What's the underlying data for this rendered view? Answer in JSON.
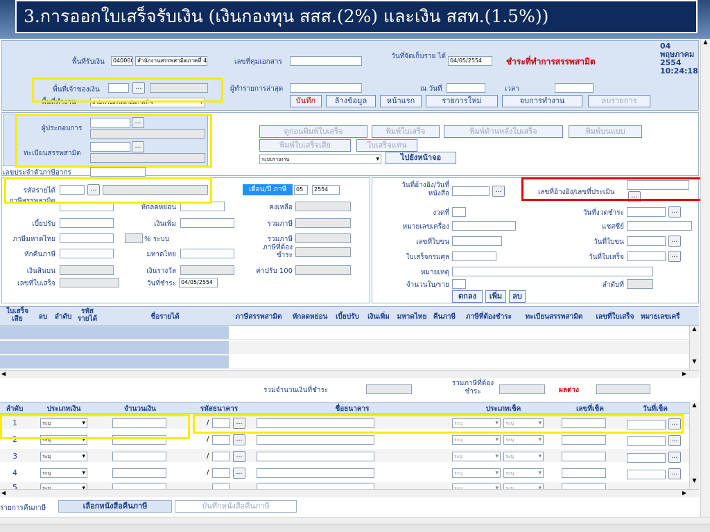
{
  "slide_title": "3.การออกใบเสร็จรับเงิน (เงินกองทุน สสส.(2%) และเงิน สสท.(1.5%))",
  "header": {
    "area_receive_label": "พื้นที่รับเงิน",
    "area_receive_code": "040000",
    "area_receive_name": "สำนักงานสรรพสามิตภาคที่ 4",
    "control_doc_label": "เลขที่คุมเอกสาร",
    "collect_date_label": "วันที่จัดเก็บราย ได้",
    "collect_date": "04/05/2554",
    "office_title": "ชำระที่ทำการสรรพสามิต",
    "clock_day": "04",
    "clock_month": "พฤษภาคม",
    "clock_year": "2554",
    "clock_time": "10:24:18",
    "owner_area_label": "พื้นที่เจ้าของเงิน",
    "work_area_label": "พื้นที่ทำงาน",
    "work_area_value": "สำนักงานสรรพสามิตภาคที่ 4",
    "last_editor_label": "ผู้ทำรายการล่าสุด",
    "at_date_label": "ณ วันที่",
    "time_label": "เวลา"
  },
  "toolbar": {
    "save": "บันทึก",
    "clear": "ล้างข้อมูล",
    "home": "หน้าแรก",
    "new_item": "รายการใหม่",
    "end_work": "จบการทำงาน",
    "delete_item": "ลบรายการ"
  },
  "operator": {
    "operator_label": "ผู้ประกอบการ",
    "excise_reg_label": "ทะเบียนสรรพสามิต",
    "tax_id_label": "เลขประจำตัวภาษีอากร"
  },
  "print_buttons": {
    "preview": "ดูก่อนพิมพ์ใบเสร็จ",
    "print_receipt": "พิมพ์ใบเสร็จ",
    "print_back": "พิมพ์ด้านหลังใบเสร็จ",
    "print_form": "พิมพ์บนแบบ",
    "print_void": "พิมพ์ใบเสร็จเสีย",
    "replace": "ใบเสร็จแทน",
    "goto_page": "ไปยังหน้าจอ",
    "select_placeholder": "ระบบรายงาน"
  },
  "revenue": {
    "code_label": "รหัสรายได้",
    "excise_label": "ภาษีสรรพสามิต",
    "surcharge_label": "เงินเพิ่ม",
    "interior_label": "ภาษีมหาดไทย",
    "refund_label": "หักคืนภาษี",
    "income_label": "เงินสินบน",
    "receipt_no_label": "เลขที่ใบเสร็จ",
    "deduct_label": "หักลดหย่อน",
    "penalty_label": "เบี้ยปรับ",
    "pct_label": "% ระบบ",
    "mahadthai_label": "มหาดไทย",
    "reward_label": "เงินรางวัล",
    "paydate_label": "วันที่ชำระ",
    "paydate_value": "04/05/2554",
    "month_year_label": "เดือน/ปี ภาษี",
    "month_value": "05",
    "year_value": "2554",
    "remain_label": "คงเหลือ",
    "total_tax_label": "รวมภาษี",
    "total_tax2_label": "รวมภาษี",
    "tax_due_label": "ภาษีที่ต้องชำระ",
    "fine100_label": "ค่าปรับ 100"
  },
  "reference": {
    "ref_date_label": "วันที่อ้างอิง/วันที่ หนังสือ",
    "ref_no_label": "เลขที่อ้างอิง/เลขที่ประเมิน",
    "period_label": "งวดที่",
    "period_date_label": "วันที่งวดชำระ",
    "machine_label": "หมายเลขเครื่อง",
    "chassis_label": "แชสซีย์",
    "license_label": "เลขที่ใบขน",
    "license_date_label": "วันที่ใบขน",
    "customs_receipt_label": "ใบเสร็จกรมศุล",
    "receipt_date_label": "วันที่ใบเสร็จ",
    "remark_label": "หมายเหตุ",
    "qty_label": "จำนวนใบ/ราย",
    "seq_label": "ลำดับที่",
    "ok": "ตกลง",
    "add": "เพิ่ม",
    "delete": "ลบ"
  },
  "grid": {
    "headers": [
      "ใบเสร็จ เสีย",
      "ลบ",
      "ลำดับ",
      "รหัส รายได้",
      "ชื่อรายได้",
      "ภาษีสรรพสามิต",
      "หักลดหย่อน",
      "เบี้ยปรับ",
      "เงินเพิ่ม",
      "มหาดไทย",
      "คืนภาษี",
      "ภาษีที่ต้องชำระ",
      "ทะเบียนสรรพสามิต",
      "เลขที่ใบเสร็จ",
      "หมายเลขเครื่"
    ]
  },
  "totals": {
    "total_pay_label": "รวมจำนวนเงินที่ชำระ",
    "total_tax_label": "รวมภาษีที่ต้อง ชำระ",
    "diff_label": "ผลต่าง"
  },
  "payment": {
    "headers": [
      "ลำดับ",
      "ประเภทเงิน",
      "จำนวนเงิน",
      "รหัสธนาคาร",
      "ชื่อธนาคาร",
      "ประเภทเช็ค",
      "เลขที่เช็ค",
      "วันที่เช็ค"
    ],
    "rows": [
      {
        "seq": "1",
        "type": "ระบุ",
        "cheque_type_a": "ระบุ",
        "cheque_type_b": "ระบุ"
      },
      {
        "seq": "2",
        "type": "ระบุ",
        "cheque_type_a": "ระบุ",
        "cheque_type_b": "ระบุ"
      },
      {
        "seq": "3",
        "type": "ระบุ",
        "cheque_type_a": "ระบุ",
        "cheque_type_b": "ระบุ"
      },
      {
        "seq": "4",
        "type": "ระบุ",
        "cheque_type_a": "ระบุ",
        "cheque_type_b": "ระบุ"
      },
      {
        "seq": "5",
        "type": "ระบุ",
        "cheque_type_a": "ระบุ",
        "cheque_type_b": "ระบุ"
      }
    ],
    "slash": "/"
  },
  "bottom_tabs": {
    "label": "รายการคืนภาษี",
    "select_letter": "เลือกหนังสือคืนภาษี",
    "save_letter": "บันทึกหนังสือคืนภาษี"
  },
  "scroll": {
    "up": "▲",
    "down": "▼",
    "left": "◀",
    "right": "▶"
  },
  "colors": {
    "banner_bg": "#0f2a5c",
    "label_blue": "#1f3f8f",
    "highlight_yellow": "#f5ee00",
    "highlight_red": "#e00000",
    "office_title": "#cc0000"
  }
}
